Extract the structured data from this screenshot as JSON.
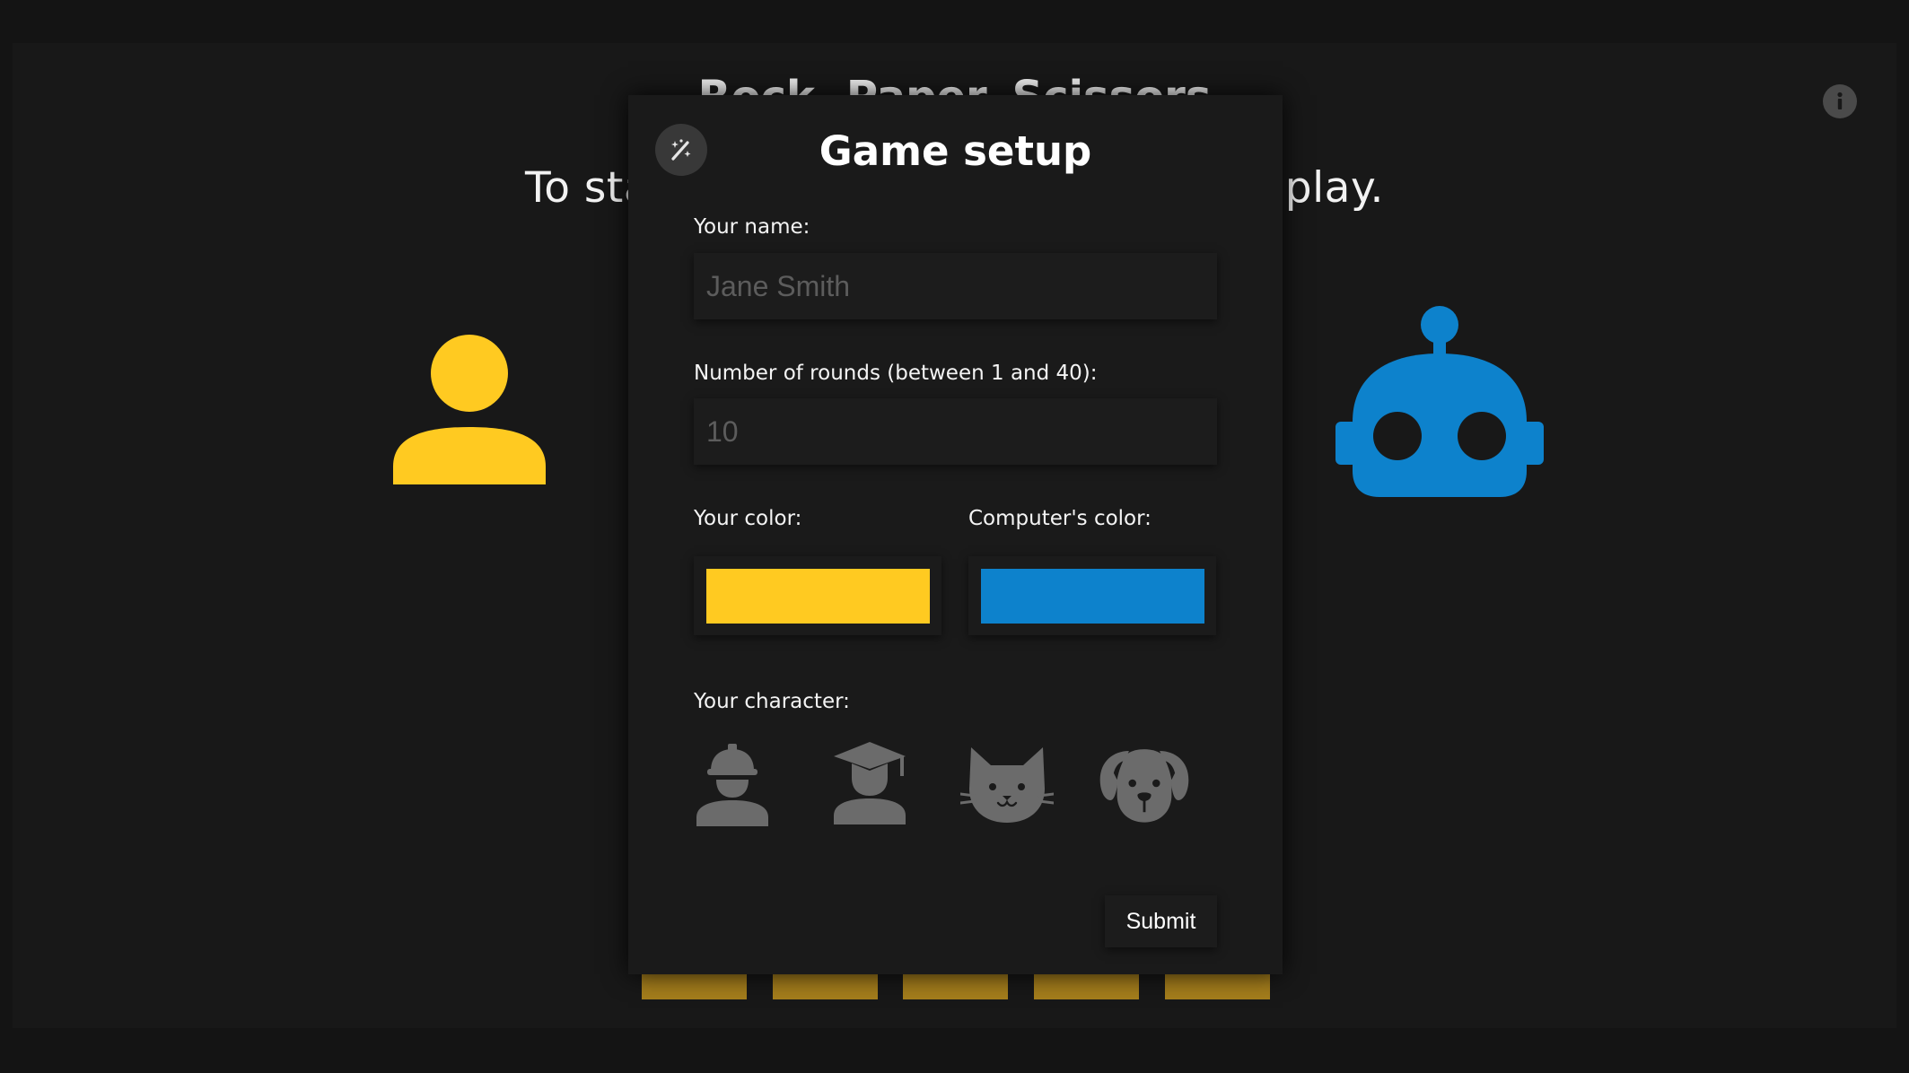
{
  "page": {
    "title": "Rock, Paper, Scissors",
    "subtitle": "To start, set up the game and click play."
  },
  "icons": {
    "info": "info-icon",
    "player_avatar": "person-icon",
    "computer_avatar": "robot-icon",
    "close": "wand-magic-icon"
  },
  "round_boxes": {
    "count": 5,
    "color": "#a57e1c"
  },
  "modal": {
    "title": "Game setup",
    "name_label": "Your name:",
    "name_value": "",
    "name_placeholder": "Jane Smith",
    "rounds_label": "Number of rounds (between 1 and 40):",
    "rounds_value": "",
    "rounds_placeholder": "10",
    "your_color_label": "Your color:",
    "your_color_value": "#ffca21",
    "computer_color_label": "Computer's color:",
    "computer_color_value": "#0d82cc",
    "character_label": "Your character:",
    "characters": [
      "construction-worker-icon",
      "graduate-icon",
      "cat-icon",
      "dog-icon"
    ],
    "submit_label": "Submit"
  }
}
